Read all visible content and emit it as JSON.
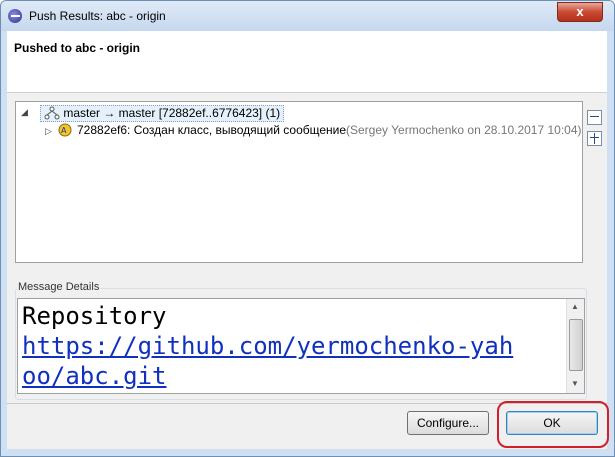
{
  "window": {
    "title": "Push Results: abc - origin",
    "close_glyph": "x"
  },
  "header": {
    "title": "Pushed to abc - origin"
  },
  "tree": {
    "rows": [
      {
        "icon": "branch-icon",
        "label": "master → master [72882ef..6776423] (1)",
        "expanded": true
      },
      {
        "icon": "commit-icon",
        "id_message": "72882ef6: Создан класс, выводящий сообщение",
        "author_date": "(Sergey Yermochenko on 28.10.2017 10:04)",
        "expanded": false
      }
    ],
    "toolbar": {
      "collapse_all": "collapse-all-icon",
      "expand_all": "expand-all-icon"
    }
  },
  "details": {
    "label": "Message Details",
    "line1": "Repository",
    "line2": "https://github.com/yermochenko-yah",
    "line3": "oo/abc.git"
  },
  "buttons": {
    "configure": "Configure...",
    "ok": "OK"
  },
  "colors": {
    "highlight": "#d0202a",
    "link": "#1030c0"
  }
}
